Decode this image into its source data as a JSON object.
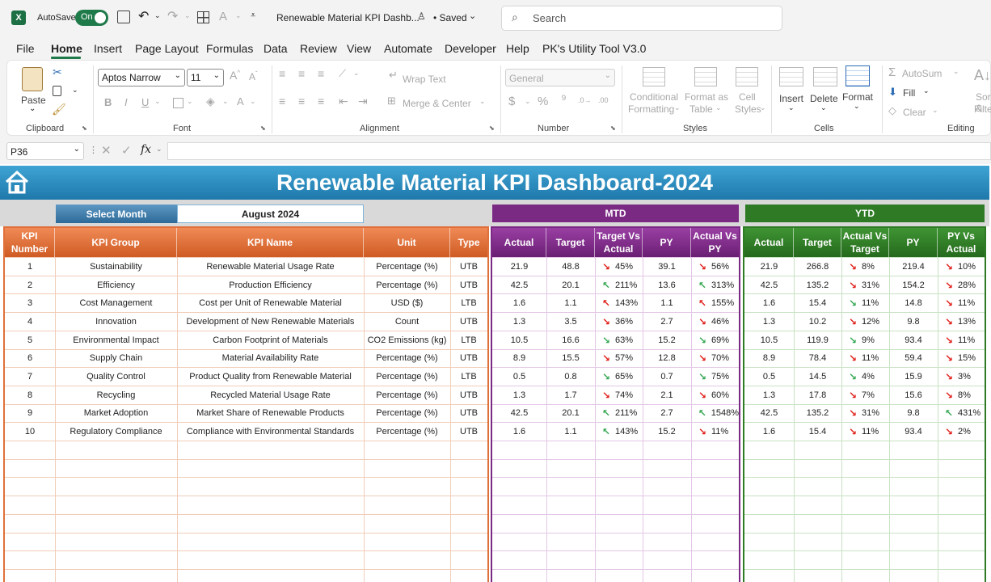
{
  "titlebar": {
    "autosave_label": "AutoSave",
    "autosave_state": "On",
    "document_title": "Renewable Material KPI Dashb...",
    "saved_status": "• Saved",
    "search_placeholder": "Search"
  },
  "menu": [
    "File",
    "Home",
    "Insert",
    "Page Layout",
    "Formulas",
    "Data",
    "Review",
    "View",
    "Automate",
    "Developer",
    "Help",
    "PK's Utility Tool V3.0"
  ],
  "ribbon": {
    "paste": "Paste",
    "clipboard": "Clipboard",
    "font_name": "Aptos Narrow",
    "font_size": "11",
    "font": "Font",
    "wrap_text": "Wrap Text",
    "merge_center": "Merge & Center",
    "alignment": "Alignment",
    "number_format": "General",
    "number": "Number",
    "cond_fmt_1": "Conditional",
    "cond_fmt_2": "Formatting",
    "format_table_1": "Format as",
    "format_table_2": "Table",
    "cell_styles_1": "Cell",
    "cell_styles_2": "Styles",
    "styles": "Styles",
    "insert": "Insert",
    "delete": "Delete",
    "format": "Format",
    "cells": "Cells",
    "autosum": "AutoSum",
    "fill": "Fill",
    "clear": "Clear",
    "sort_1": "Sort &",
    "sort_2": "Filter",
    "editing": "Editing"
  },
  "formula_bar": {
    "name_box": "P36",
    "fx": "fx",
    "content": ""
  },
  "dashboard": {
    "title": "Renewable Material KPI Dashboard-2024",
    "select_month_label": "Select Month",
    "selected_month": "August 2024",
    "mtd_label": "MTD",
    "ytd_label": "YTD",
    "left_headers": [
      "KPI Number",
      "KPI Group",
      "KPI Name",
      "Unit",
      "Type"
    ],
    "mtd_headers": [
      "Actual",
      "Target",
      "Target Vs Actual",
      "PY",
      "Actual Vs PY"
    ],
    "ytd_headers": [
      "Actual",
      "Target",
      "Actual Vs Target",
      "PY",
      "PY Vs Actual"
    ],
    "colors": {
      "title_bar": "#2e8fc0",
      "orange": "#e0703a",
      "mtd": "#7b2a84",
      "ytd": "#2e7a25",
      "up": "#35a853",
      "down": "#e0201b"
    },
    "rows": [
      {
        "num": "1",
        "group": "Sustainability",
        "name": "Renewable Material Usage Rate",
        "unit": "Percentage (%)",
        "type": "UTB",
        "m_act": "21.9",
        "m_tgt": "48.8",
        "m_tva_dir": "down",
        "m_tva": "45%",
        "m_py": "39.1",
        "m_avp_dir": "down",
        "m_avp": "56%",
        "y_act": "21.9",
        "y_tgt": "266.8",
        "y_avt_dir": "down",
        "y_avt": "8%",
        "y_py": "219.4",
        "y_pva_dir": "down",
        "y_pva": "10%"
      },
      {
        "num": "2",
        "group": "Efficiency",
        "name": "Production Efficiency",
        "unit": "Percentage (%)",
        "type": "UTB",
        "m_act": "42.5",
        "m_tgt": "20.1",
        "m_tva_dir": "up",
        "m_tva": "211%",
        "m_py": "13.6",
        "m_avp_dir": "up",
        "m_avp": "313%",
        "y_act": "42.5",
        "y_tgt": "135.2",
        "y_avt_dir": "down",
        "y_avt": "31%",
        "y_py": "154.2",
        "y_pva_dir": "down",
        "y_pva": "28%"
      },
      {
        "num": "3",
        "group": "Cost Management",
        "name": "Cost per Unit of Renewable Material",
        "unit": "USD ($)",
        "type": "LTB",
        "m_act": "1.6",
        "m_tgt": "1.1",
        "m_tva_dir": "upred",
        "m_tva": "143%",
        "m_py": "1.1",
        "m_avp_dir": "upred",
        "m_avp": "155%",
        "y_act": "1.6",
        "y_tgt": "15.4",
        "y_avt_dir": "downgreen",
        "y_avt": "11%",
        "y_py": "14.8",
        "y_pva_dir": "down",
        "y_pva": "11%"
      },
      {
        "num": "4",
        "group": "Innovation",
        "name": "Development of New Renewable Materials",
        "unit": "Count",
        "type": "UTB",
        "m_act": "1.3",
        "m_tgt": "3.5",
        "m_tva_dir": "down",
        "m_tva": "36%",
        "m_py": "2.7",
        "m_avp_dir": "down",
        "m_avp": "46%",
        "y_act": "1.3",
        "y_tgt": "10.2",
        "y_avt_dir": "down",
        "y_avt": "12%",
        "y_py": "9.8",
        "y_pva_dir": "down",
        "y_pva": "13%"
      },
      {
        "num": "5",
        "group": "Environmental Impact",
        "name": "Carbon Footprint of Materials",
        "unit": "CO2 Emissions (kg)",
        "type": "LTB",
        "m_act": "10.5",
        "m_tgt": "16.6",
        "m_tva_dir": "downgreen",
        "m_tva": "63%",
        "m_py": "15.2",
        "m_avp_dir": "downgreen",
        "m_avp": "69%",
        "y_act": "10.5",
        "y_tgt": "119.9",
        "y_avt_dir": "downgreen",
        "y_avt": "9%",
        "y_py": "93.4",
        "y_pva_dir": "down",
        "y_pva": "11%"
      },
      {
        "num": "6",
        "group": "Supply Chain",
        "name": "Material Availability Rate",
        "unit": "Percentage (%)",
        "type": "UTB",
        "m_act": "8.9",
        "m_tgt": "15.5",
        "m_tva_dir": "down",
        "m_tva": "57%",
        "m_py": "12.8",
        "m_avp_dir": "down",
        "m_avp": "70%",
        "y_act": "8.9",
        "y_tgt": "78.4",
        "y_avt_dir": "down",
        "y_avt": "11%",
        "y_py": "59.4",
        "y_pva_dir": "down",
        "y_pva": "15%"
      },
      {
        "num": "7",
        "group": "Quality Control",
        "name": "Product Quality from Renewable Material",
        "unit": "Percentage (%)",
        "type": "LTB",
        "m_act": "0.5",
        "m_tgt": "0.8",
        "m_tva_dir": "downgreen",
        "m_tva": "65%",
        "m_py": "0.7",
        "m_avp_dir": "downgreen",
        "m_avp": "75%",
        "y_act": "0.5",
        "y_tgt": "14.5",
        "y_avt_dir": "downgreen",
        "y_avt": "4%",
        "y_py": "15.9",
        "y_pva_dir": "down",
        "y_pva": "3%"
      },
      {
        "num": "8",
        "group": "Recycling",
        "name": "Recycled Material Usage Rate",
        "unit": "Percentage (%)",
        "type": "UTB",
        "m_act": "1.3",
        "m_tgt": "1.7",
        "m_tva_dir": "down",
        "m_tva": "74%",
        "m_py": "2.1",
        "m_avp_dir": "down",
        "m_avp": "60%",
        "y_act": "1.3",
        "y_tgt": "17.8",
        "y_avt_dir": "down",
        "y_avt": "7%",
        "y_py": "15.6",
        "y_pva_dir": "down",
        "y_pva": "8%"
      },
      {
        "num": "9",
        "group": "Market Adoption",
        "name": "Market Share of Renewable Products",
        "unit": "Percentage (%)",
        "type": "UTB",
        "m_act": "42.5",
        "m_tgt": "20.1",
        "m_tva_dir": "up",
        "m_tva": "211%",
        "m_py": "2.7",
        "m_avp_dir": "up",
        "m_avp": "1548%",
        "y_act": "42.5",
        "y_tgt": "135.2",
        "y_avt_dir": "down",
        "y_avt": "31%",
        "y_py": "9.8",
        "y_pva_dir": "up",
        "y_pva": "431%"
      },
      {
        "num": "10",
        "group": "Regulatory Compliance",
        "name": "Compliance with Environmental Standards",
        "unit": "Percentage (%)",
        "type": "UTB",
        "m_act": "1.6",
        "m_tgt": "1.1",
        "m_tva_dir": "up",
        "m_tva": "143%",
        "m_py": "15.2",
        "m_avp_dir": "down",
        "m_avp": "11%",
        "y_act": "1.6",
        "y_tgt": "15.4",
        "y_avt_dir": "down",
        "y_avt": "11%",
        "y_py": "93.4",
        "y_pva_dir": "down",
        "y_pva": "2%"
      }
    ]
  }
}
